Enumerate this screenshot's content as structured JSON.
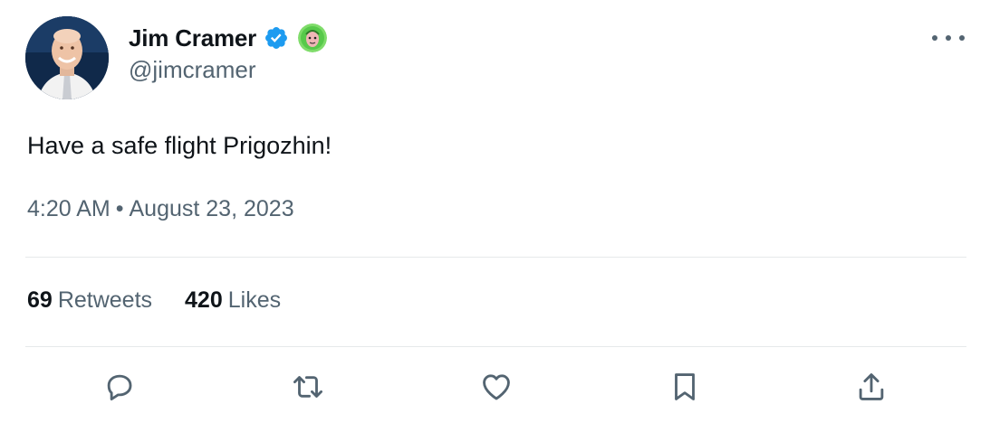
{
  "author": {
    "display_name": "Jim Cramer",
    "handle": "@jimcramer",
    "verified": true,
    "avatar_icon": "avatar-photo",
    "affiliate_badge_icon": "green-avatar-badge"
  },
  "tweet": {
    "text": "Have a safe flight Prigozhin!",
    "time": "4:20 AM",
    "separator": "•",
    "date": "August 23, 2023"
  },
  "stats": {
    "retweets_count": "69",
    "retweets_label": "Retweets",
    "likes_count": "420",
    "likes_label": "Likes"
  },
  "actions": [
    {
      "name": "reply",
      "icon": "reply-icon"
    },
    {
      "name": "retweet",
      "icon": "retweet-icon"
    },
    {
      "name": "like",
      "icon": "heart-icon"
    },
    {
      "name": "bookmark",
      "icon": "bookmark-icon"
    },
    {
      "name": "share",
      "icon": "share-icon"
    }
  ],
  "colors": {
    "primary_text": "#0f1419",
    "secondary_text": "#536471",
    "verified_blue": "#1d9bf0",
    "divider": "#e6e9ea"
  }
}
